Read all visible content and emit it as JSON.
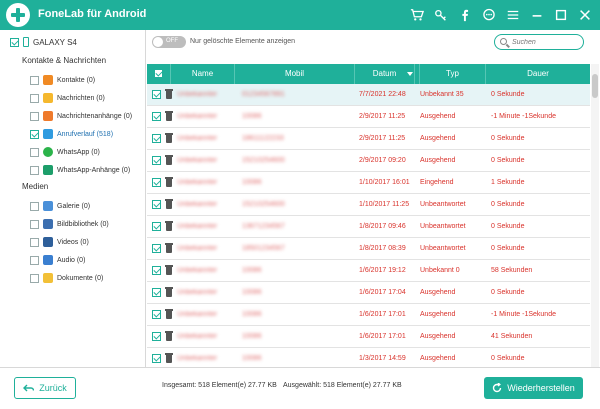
{
  "app": {
    "title": "FoneLab für Android"
  },
  "colors": {
    "accent": "#1fb09a",
    "status_red": "#d9322b",
    "selected_row": "#e6f4f6"
  },
  "titlebar_icons": [
    "cart-icon",
    "key-icon",
    "facebook-icon",
    "chat-icon",
    "menu-icon",
    "minimize-icon",
    "maximize-icon",
    "close-icon"
  ],
  "device": {
    "name": "GALAXY S4"
  },
  "sidebar": {
    "section_contacts": "Kontakte & Nachrichten",
    "section_media": "Medien",
    "contacts_items": [
      {
        "label": "Kontakte (0)",
        "icon": "contacts-icon",
        "checked": false
      },
      {
        "label": "Nachrichten (0)",
        "icon": "messages-icon",
        "checked": false
      },
      {
        "label": "Nachrichtenanhänge (0)",
        "icon": "attachments-icon",
        "checked": false
      },
      {
        "label": "Anrufverlauf (518)",
        "icon": "call-log-icon",
        "checked": true
      },
      {
        "label": "WhatsApp (0)",
        "icon": "whatsapp-icon",
        "checked": false
      },
      {
        "label": "WhatsApp-Anhänge (0)",
        "icon": "whatsapp-attachments-icon",
        "checked": false
      }
    ],
    "media_items": [
      {
        "label": "Galerie (0)",
        "icon": "gallery-icon"
      },
      {
        "label": "Bildbibliothek (0)",
        "icon": "picture-library-icon"
      },
      {
        "label": "Videos (0)",
        "icon": "videos-icon"
      },
      {
        "label": "Audio (0)",
        "icon": "audio-icon"
      },
      {
        "label": "Dokumente (0)",
        "icon": "documents-icon"
      }
    ]
  },
  "toolbar": {
    "toggle_state": "OFF",
    "toggle_label": "Nur gelöschte Elemente anzeigen",
    "search_placeholder": "Suchen"
  },
  "table": {
    "headers": {
      "name": "Name",
      "mobil": "Mobil",
      "datum": "Datum",
      "typ": "Typ",
      "dauer": "Dauer"
    },
    "rows": [
      {
        "name": "Unbekannter",
        "mobil": "01234567891",
        "datum": "7/7/2021 22:48",
        "typ": "Unbekannt 35",
        "dauer": "0 Sekunde",
        "selected": true
      },
      {
        "name": "Unbekannter",
        "mobil": "10086",
        "datum": "2/9/2017 11:25",
        "typ": "Ausgehend",
        "dauer": "-1 Minute -1Sekunde",
        "selected": false
      },
      {
        "name": "Unbekannter",
        "mobil": "18611122233",
        "datum": "2/9/2017 11:25",
        "typ": "Ausgehend",
        "dauer": "0 Sekunde",
        "selected": false
      },
      {
        "name": "Unbekannter",
        "mobil": "15210254600",
        "datum": "2/9/2017 09:20",
        "typ": "Ausgehend",
        "dauer": "0 Sekunde",
        "selected": false
      },
      {
        "name": "Unbekannter",
        "mobil": "10086",
        "datum": "1/10/2017 16:01",
        "typ": "Eingehend",
        "dauer": "1 Sekunde",
        "selected": false
      },
      {
        "name": "Unbekannter",
        "mobil": "15210254600",
        "datum": "1/10/2017 11:25",
        "typ": "Unbeantwortet",
        "dauer": "0 Sekunde",
        "selected": false
      },
      {
        "name": "Unbekannter",
        "mobil": "13671234567",
        "datum": "1/8/2017 09:46",
        "typ": "Unbeantwortet",
        "dauer": "0 Sekunde",
        "selected": false
      },
      {
        "name": "Unbekannter",
        "mobil": "18501234567",
        "datum": "1/8/2017 08:39",
        "typ": "Unbeantwortet",
        "dauer": "0 Sekunde",
        "selected": false
      },
      {
        "name": "Unbekannter",
        "mobil": "10086",
        "datum": "1/6/2017 19:12",
        "typ": "Unbekannt 0",
        "dauer": "58 Sekunden",
        "selected": false
      },
      {
        "name": "Unbekannter",
        "mobil": "10086",
        "datum": "1/6/2017 17:04",
        "typ": "Ausgehend",
        "dauer": "0 Sekunde",
        "selected": false
      },
      {
        "name": "Unbekannter",
        "mobil": "10086",
        "datum": "1/6/2017 17:01",
        "typ": "Ausgehend",
        "dauer": "-1 Minute -1Sekunde",
        "selected": false
      },
      {
        "name": "Unbekannter",
        "mobil": "10086",
        "datum": "1/6/2017 17:01",
        "typ": "Ausgehend",
        "dauer": "41 Sekunden",
        "selected": false
      },
      {
        "name": "Unbekannter",
        "mobil": "10086",
        "datum": "1/3/2017 14:59",
        "typ": "Ausgehend",
        "dauer": "0 Sekunde",
        "selected": false
      }
    ]
  },
  "footer": {
    "back_label": "Zurück",
    "total": "Insgesamt: 518 Element(e) 27.77 KB",
    "selected": "Ausgewählt: 518 Element(e) 27.77 KB",
    "restore_label": "Wiederherstellen"
  }
}
